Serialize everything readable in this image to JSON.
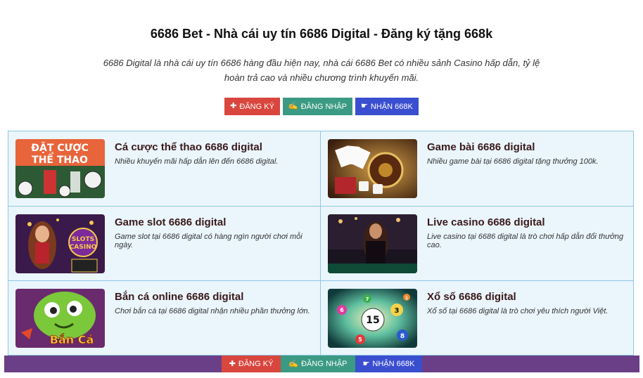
{
  "header": {
    "title": "6686 Bet - Nhà cái uy tín 6686 Digital - Đăng ký tặng 668k",
    "description": "6686 Digital là nhà cái uy tín 6686 hàng đầu hiện nay, nhà cái 6686 Bet có nhiều sảnh Casino hấp dẫn, tỷ lệ hoàn trả cao và nhiều chương trình khuyến mãi."
  },
  "cta": {
    "register": {
      "icon": "✚",
      "label": "ĐĂNG KÝ"
    },
    "login": {
      "icon": "✍",
      "label": "ĐĂNG NHẬP"
    },
    "bonus": {
      "icon": "☛",
      "label": "NHẬN 668K"
    }
  },
  "cards": [
    {
      "title": "Cá cược thể thao 6686 digital",
      "desc": "Nhiều khuyến mãi hấp dẫn lên đến 6686 digital.",
      "thumb_text": [
        "ĐẶT CƯỢC",
        "THỂ THAO"
      ]
    },
    {
      "title": "Game bài 6686 digital",
      "desc": "Nhiều game bài tại 6686 digital tặng thưởng 100k."
    },
    {
      "title": "Game slot 6686 digital",
      "desc": "Game slot tại 6686 digital có hàng ngìn người chơi mỗi ngày.",
      "thumb_text": [
        "SLOTS",
        "CASINO"
      ]
    },
    {
      "title": "Live casino 6686 digital",
      "desc": "Live casino tại 6686 digital là trò chơi hấp dẫn đổi thưởng cao."
    },
    {
      "title": "Bắn cá online 6686 digital",
      "desc": "Chơi bắn cá tại 6686 digital nhận nhiều phần thưởng lớn.",
      "thumb_text": [
        "Bắn Cá"
      ]
    },
    {
      "title": "Xổ số 6686 digital",
      "desc": "Xổ số tại 6686 digital là trò chơi yêu thích người Việt.",
      "thumb_text": [
        "15",
        "3",
        "8",
        "5",
        "6",
        "7",
        "1"
      ]
    }
  ],
  "bottom_bar": {
    "register": {
      "icon": "✚",
      "label": "ĐĂNG KÝ"
    },
    "login": {
      "icon": "✍",
      "label": "ĐĂNG NHẬP"
    },
    "bonus": {
      "icon": "☛",
      "label": "NHẬN 668K"
    }
  },
  "colors": {
    "register_red": "#d9463e",
    "login_teal": "#3b9a83",
    "bonus_blue": "#3a4ed0",
    "bottom_bar_purple": "#6a3f87",
    "grid_bg": "#eaf5fc",
    "grid_border": "#8fc8e6"
  }
}
